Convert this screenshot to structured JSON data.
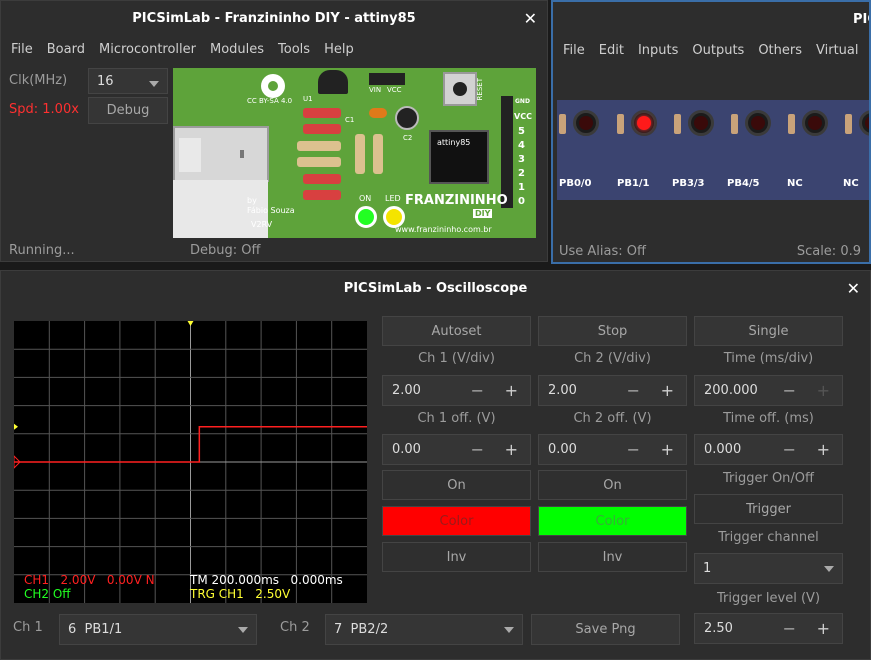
{
  "board_window": {
    "title": "PICSimLab - Franzininho DIY - attiny85",
    "menu": [
      "File",
      "Board",
      "Microcontroller",
      "Modules",
      "Tools",
      "Help"
    ],
    "clk_label": "Clk(MHz)",
    "clk_value": "16",
    "spd_label": "Spd: 1.00x",
    "debug_button": "Debug",
    "status_running": "Running...",
    "status_debug": "Debug: Off",
    "pcb": {
      "license": "CC BY-SA 4.0",
      "author": "by\nFábio Souza",
      "version": "V2RV",
      "brand": "FRANZININHO",
      "brand_sub": "DIY",
      "url": "www.franzininho.com.br",
      "chip": "attiny85",
      "u1": "U1",
      "c1": "C1",
      "c2": "C2",
      "on_label": "ON",
      "led_label": "LED",
      "pins_header": [
        "GND",
        "VCC",
        "5",
        "4",
        "3",
        "2",
        "1",
        "0"
      ],
      "reset_label": "RESET",
      "vin": "VIN",
      "vcc": "VCC"
    }
  },
  "leds_window": {
    "title": "PIC",
    "menu": [
      "File",
      "Edit",
      "Inputs",
      "Outputs",
      "Others",
      "Virtual"
    ],
    "leds": [
      {
        "label": "PB0/0",
        "on": false
      },
      {
        "label": "PB1/1",
        "on": true
      },
      {
        "label": "PB3/3",
        "on": false
      },
      {
        "label": "PB4/5",
        "on": false
      },
      {
        "label": "NC",
        "on": false
      },
      {
        "label": "NC",
        "on": false
      },
      {
        "label": "",
        "on": false
      }
    ],
    "alias_status": "Use Alias: Off",
    "scale_status": "Scale: 0.9"
  },
  "scope_window": {
    "title": "PICSimLab - Oscilloscope",
    "autoset": "Autoset",
    "stop": "Stop",
    "single": "Single",
    "ch1_vdiv_label": "Ch 1 (V/div)",
    "ch1_vdiv_value": "2.00",
    "ch2_vdiv_label": "Ch 2 (V/div)",
    "ch2_vdiv_value": "2.00",
    "time_label": "Time (ms/div)",
    "time_value": "200.000",
    "ch1_off_label": "Ch 1 off. (V)",
    "ch1_off_value": "0.00",
    "ch2_off_label": "Ch 2 off. (V)",
    "ch2_off_value": "0.00",
    "time_off_label": "Time off. (ms)",
    "time_off_value": "0.000",
    "ch1_on": "On",
    "ch2_on": "On",
    "trigger_onoff_label": "Trigger On/Off",
    "trigger_button": "Trigger",
    "ch1_color": "Color",
    "ch2_color": "Color",
    "ch1_color_hex": "#ff0000",
    "ch2_color_hex": "#00ff00",
    "trigger_channel_label": "Trigger channel",
    "trigger_channel_value": "1",
    "ch1_inv": "Inv",
    "ch2_inv": "Inv",
    "trigger_level_label": "Trigger level (V)",
    "trigger_level_value": "2.50",
    "ch1_select_label": "Ch 1",
    "ch1_select_value": "6  PB1/1",
    "ch2_select_label": "Ch 2",
    "ch2_select_value": "7  PB2/2",
    "save_png": "Save Png",
    "screen": {
      "ch1_info": "CH1   2.00V   0.00V N",
      "ch2_info": "CH2 Off",
      "tm_info": "TM 200.000ms   0.000ms",
      "trg_info": "TRG CH1   2.50V"
    }
  },
  "chart_data": {
    "type": "line",
    "series": [
      {
        "name": "CH1",
        "color": "#ff2020",
        "x_div": [
          0,
          5.25,
          5.25,
          10
        ],
        "y_div": [
          0,
          0,
          1.25,
          1.25
        ]
      }
    ],
    "x_divisions": 10,
    "y_divisions": 10,
    "volts_per_div": 2.0,
    "time_per_div_ms": 200.0,
    "grid": true
  }
}
